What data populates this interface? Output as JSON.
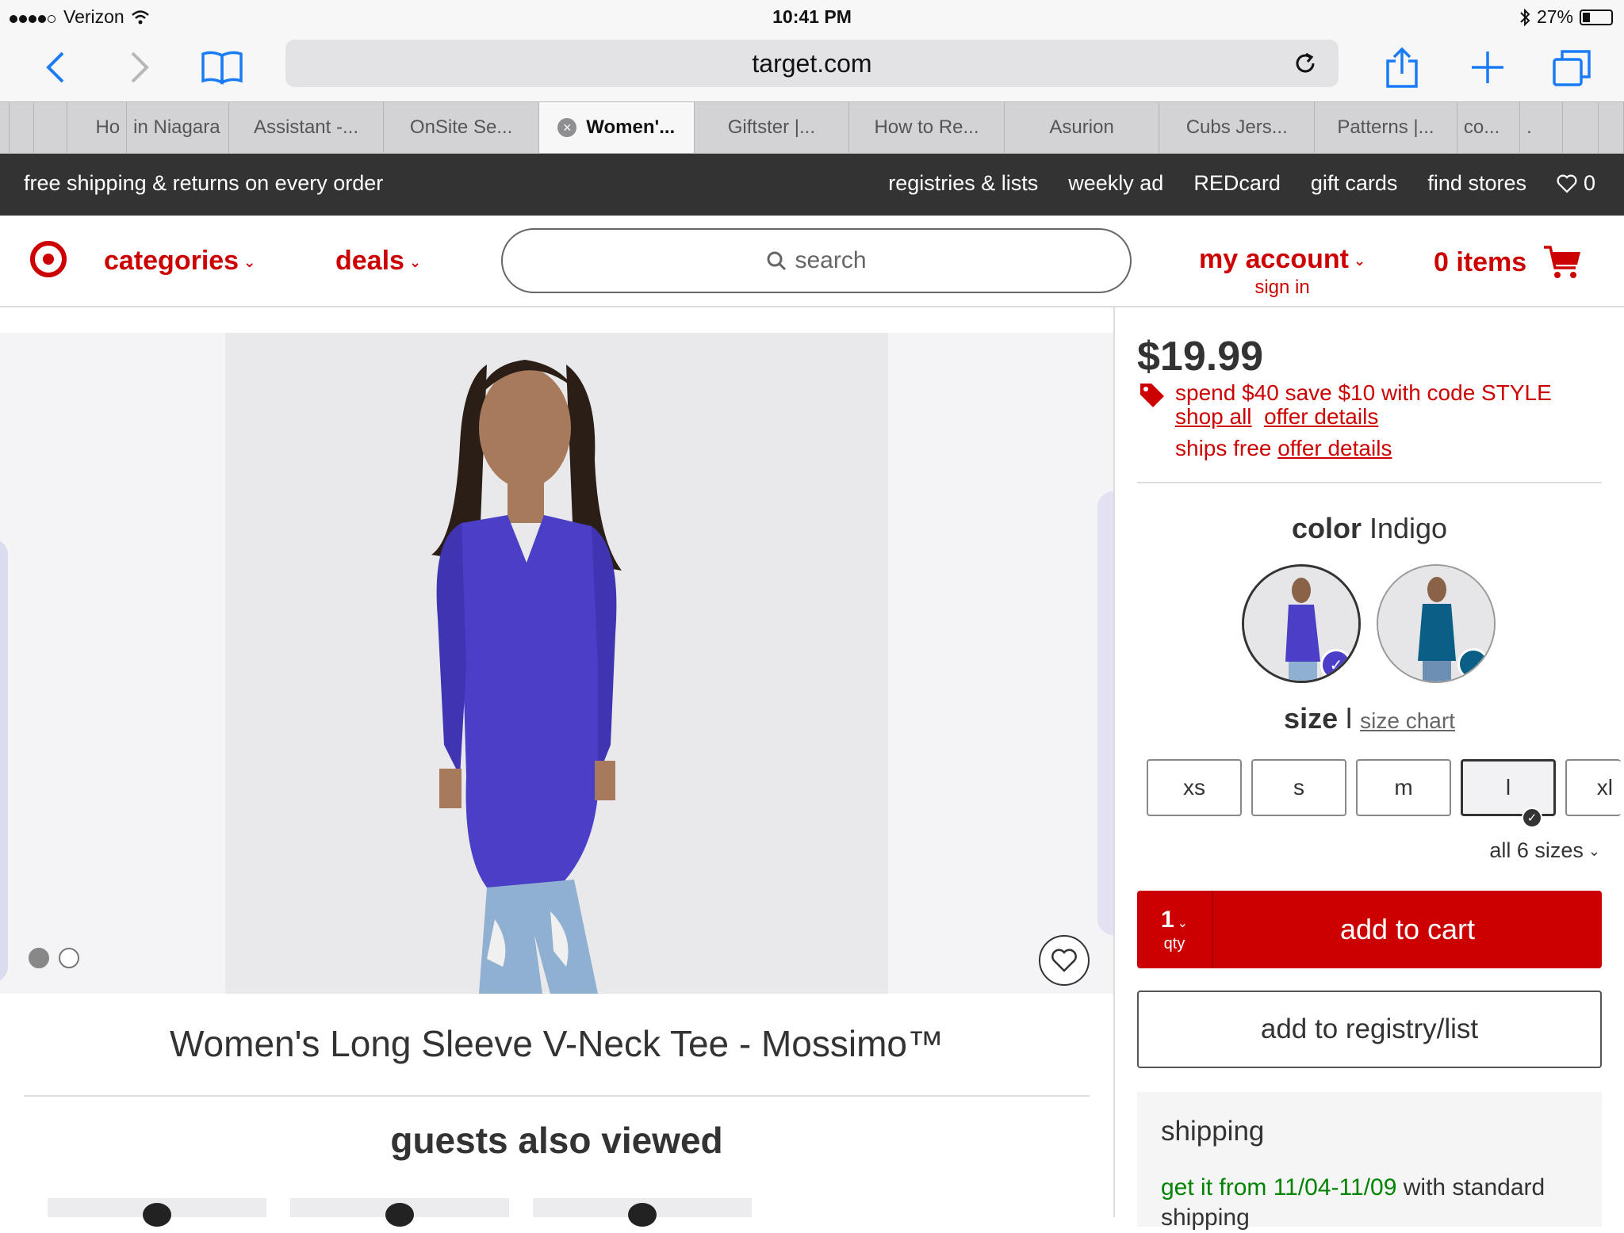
{
  "status": {
    "carrier": "Verizon",
    "time": "10:41 PM",
    "battery": "27%"
  },
  "browser": {
    "url": "target.com"
  },
  "tabs": [
    {
      "label": "Ho"
    },
    {
      "label": "in Niagara"
    },
    {
      "label": "Assistant -..."
    },
    {
      "label": "OnSite Se..."
    },
    {
      "label": "Women'..."
    },
    {
      "label": "Giftster |..."
    },
    {
      "label": "How to Re..."
    },
    {
      "label": "Asurion"
    },
    {
      "label": "Cubs Jers..."
    },
    {
      "label": "Patterns |..."
    },
    {
      "label": "co..."
    },
    {
      "label": "."
    }
  ],
  "promo": {
    "text": "free shipping & returns on every order",
    "links": [
      "registries & lists",
      "weekly ad",
      "REDcard",
      "gift cards",
      "find stores"
    ],
    "favorites_count": "0"
  },
  "header": {
    "categories": "categories",
    "deals": "deals",
    "search_placeholder": "search",
    "account": "my account",
    "sign_in": "sign in",
    "cart": "0 items"
  },
  "product": {
    "title": "Women's Long Sleeve V-Neck Tee - Mossimo™",
    "price": "$19.99",
    "offer": "spend $40 save $10 with code STYLE",
    "shop_all": "shop all",
    "offer_details": "offer details",
    "ships_free": "ships free",
    "ships_free_details": "offer details",
    "color_label": "color",
    "color_value": "Indigo",
    "size_label": "size",
    "size_value": "l",
    "size_chart": "size chart",
    "sizes": [
      "xs",
      "s",
      "m",
      "l",
      "xl"
    ],
    "all_sizes": "all 6 sizes",
    "qty": "1",
    "qty_label": "qty",
    "add_to_cart": "add to cart",
    "add_to_registry": "add to registry/list",
    "shipping_heading": "shipping",
    "shipping_dates": "get it from 11/04-11/09",
    "shipping_rest": " with standard shipping"
  },
  "section": {
    "guests_also_viewed": "guests also viewed"
  },
  "colors": {
    "brand": "#cc0000",
    "indigo": "#4b3fc7",
    "teal": "#0b5f86"
  }
}
